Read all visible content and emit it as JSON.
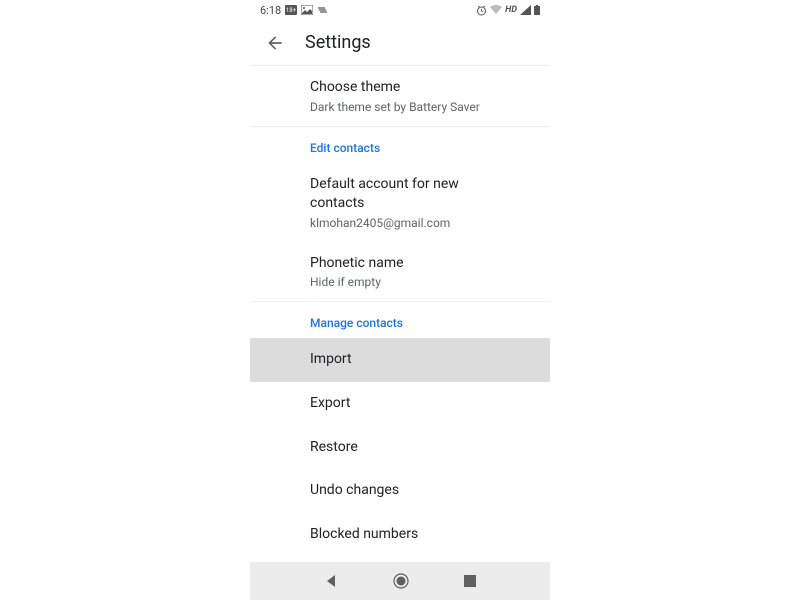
{
  "status_bar": {
    "time": "6:18",
    "hd_label": "HD"
  },
  "header": {
    "title": "Settings"
  },
  "sections": {
    "display": {
      "items": [
        {
          "title": "Choose theme",
          "subtitle": "Dark theme set by Battery Saver"
        }
      ]
    },
    "edit_contacts": {
      "label": "Edit contacts",
      "items": [
        {
          "title": "Default account for new contacts",
          "subtitle": "klmohan2405@gmail.com"
        },
        {
          "title": "Phonetic name",
          "subtitle": "Hide if empty"
        }
      ]
    },
    "manage_contacts": {
      "label": "Manage contacts",
      "items": [
        {
          "title": "Import"
        },
        {
          "title": "Export"
        },
        {
          "title": "Restore"
        },
        {
          "title": "Undo changes"
        },
        {
          "title": "Blocked numbers"
        }
      ]
    }
  }
}
